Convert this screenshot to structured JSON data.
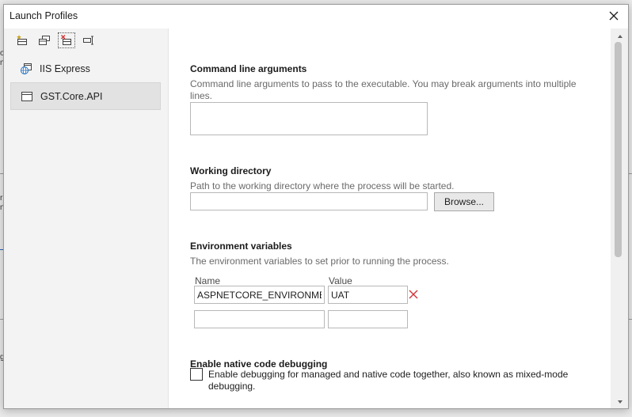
{
  "window": {
    "title": "Launch Profiles"
  },
  "toolbar": {
    "buttons": [
      {
        "icon": "new-profile-icon"
      },
      {
        "icon": "duplicate-profile-icon"
      },
      {
        "icon": "delete-profile-icon"
      },
      {
        "icon": "rename-profile-icon"
      }
    ]
  },
  "profiles": [
    {
      "label": "IIS Express",
      "icon": "web-globe-icon",
      "selected": false
    },
    {
      "label": "GST.Core.API",
      "icon": "window-icon",
      "selected": true
    }
  ],
  "command_line": {
    "title": "Command line arguments",
    "description": "Command line arguments to pass to the executable. You may break arguments into multiple lines.",
    "value": ""
  },
  "working_directory": {
    "title": "Working directory",
    "description": "Path to the working directory where the process will be started.",
    "value": "",
    "browse_label": "Browse..."
  },
  "env_vars": {
    "title": "Environment variables",
    "description": "The environment variables to set prior to running the process.",
    "name_header": "Name",
    "value_header": "Value",
    "rows": [
      {
        "name": "ASPNETCORE_ENVIRONMENT",
        "value": "UAT"
      },
      {
        "name": "",
        "value": ""
      }
    ]
  },
  "native_debug": {
    "title": "Enable native code debugging",
    "checkbox_label": "Enable debugging for managed and native code together, also known as mixed-mode debugging.",
    "checked": false
  },
  "colors": {
    "delete_red": "#d13438",
    "sidebar_bg": "#f3f3f3",
    "selected_bg": "#e2e2e2"
  }
}
